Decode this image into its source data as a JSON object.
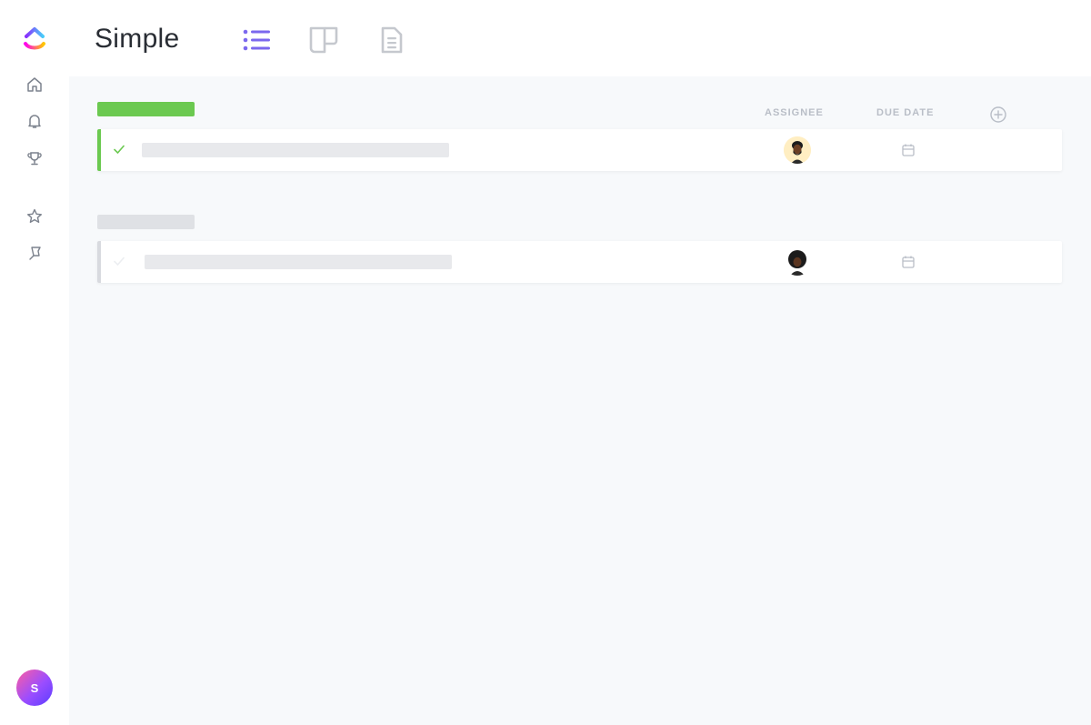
{
  "app": {
    "brand_colors": {
      "orange": "#ff7a2d",
      "pink": "#ff3d7f",
      "purple": "#7b68ee",
      "blue": "#49ccf9"
    }
  },
  "sidebar": {
    "logo_icon": "clickup-logo-icon",
    "items": [
      {
        "icon": "home-icon"
      },
      {
        "icon": "bell-icon"
      },
      {
        "icon": "trophy-icon"
      },
      {
        "icon": "star-icon"
      },
      {
        "icon": "pin-icon"
      }
    ],
    "user_avatar_initial": "S"
  },
  "header": {
    "title": "Simple",
    "views": [
      {
        "icon": "list-view-icon",
        "active": true,
        "color": "#7b68ee"
      },
      {
        "icon": "board-view-icon",
        "active": false,
        "color": "#c5c8ce"
      },
      {
        "icon": "doc-view-icon",
        "active": false,
        "color": "#c5c8ce"
      }
    ]
  },
  "columns": {
    "assignee": "ASSIGNEE",
    "due_date": "DUE DATE",
    "add_icon": "plus-circle-icon"
  },
  "groups": [
    {
      "status_color": "#6bc950",
      "tasks": [
        {
          "completed": true,
          "assignee_icon": "avatar-person-1",
          "due_icon": "calendar-icon"
        }
      ]
    },
    {
      "status_color": "#d8dadf",
      "tasks": [
        {
          "completed": false,
          "assignee_icon": "avatar-person-2",
          "due_icon": "calendar-icon"
        }
      ]
    }
  ]
}
